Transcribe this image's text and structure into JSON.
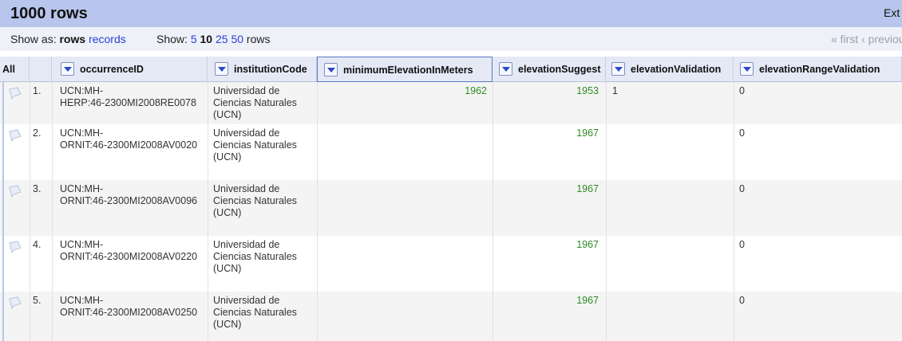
{
  "header": {
    "title": "1000 rows",
    "extensions_label": "Ext"
  },
  "viewbar": {
    "show_as_label": "Show as:",
    "rows_option": "rows",
    "records_option": "records",
    "show_label": "Show:",
    "page_sizes": [
      "5",
      "10",
      "25",
      "50"
    ],
    "rows_suffix": "rows",
    "pager": "« first ‹ previou"
  },
  "columns": {
    "all": "All",
    "c1": "occurrenceID",
    "c2": "institutionCode",
    "c3": "minimumElevationInMeters",
    "c4": "elevationSuggest",
    "c5": "elevationValidation",
    "c6": "elevationRangeValidation"
  },
  "rows": [
    {
      "index": "1.",
      "id1": "UCN:MH-",
      "id2": "HERP:46-2300MI2008RE0078",
      "inst1": "Universidad de",
      "inst2": "Ciencias Naturales",
      "inst3": "(UCN)",
      "minElev": "1962",
      "sugg": "1953",
      "valid": "1",
      "range": "0"
    },
    {
      "index": "2.",
      "id1": "UCN:MH-",
      "id2": "ORNIT:46-2300MI2008AV0020",
      "inst1": "Universidad de",
      "inst2": "Ciencias Naturales",
      "inst3": "(UCN)",
      "minElev": "",
      "sugg": "1967",
      "valid": "",
      "range": "0"
    },
    {
      "index": "3.",
      "id1": "UCN:MH-",
      "id2": "ORNIT:46-2300MI2008AV0096",
      "inst1": "Universidad de",
      "inst2": "Ciencias Naturales",
      "inst3": "(UCN)",
      "minElev": "",
      "sugg": "1967",
      "valid": "",
      "range": "0"
    },
    {
      "index": "4.",
      "id1": "UCN:MH-",
      "id2": "ORNIT:46-2300MI2008AV0220",
      "inst1": "Universidad de",
      "inst2": "Ciencias Naturales",
      "inst3": "(UCN)",
      "minElev": "",
      "sugg": "1967",
      "valid": "",
      "range": "0"
    },
    {
      "index": "5.",
      "id1": "UCN:MH-",
      "id2": "ORNIT:46-2300MI2008AV0250",
      "inst1": "Universidad de",
      "inst2": "Ciencias Naturales",
      "inst3": "(UCN)",
      "minElev": "",
      "sugg": "1967",
      "valid": "",
      "range": "0"
    }
  ],
  "colors": {
    "header_bg": "#b8c6ed",
    "link": "#2b3fd6",
    "number": "#2e8a24",
    "selected_col_border": "#5a78c9"
  }
}
